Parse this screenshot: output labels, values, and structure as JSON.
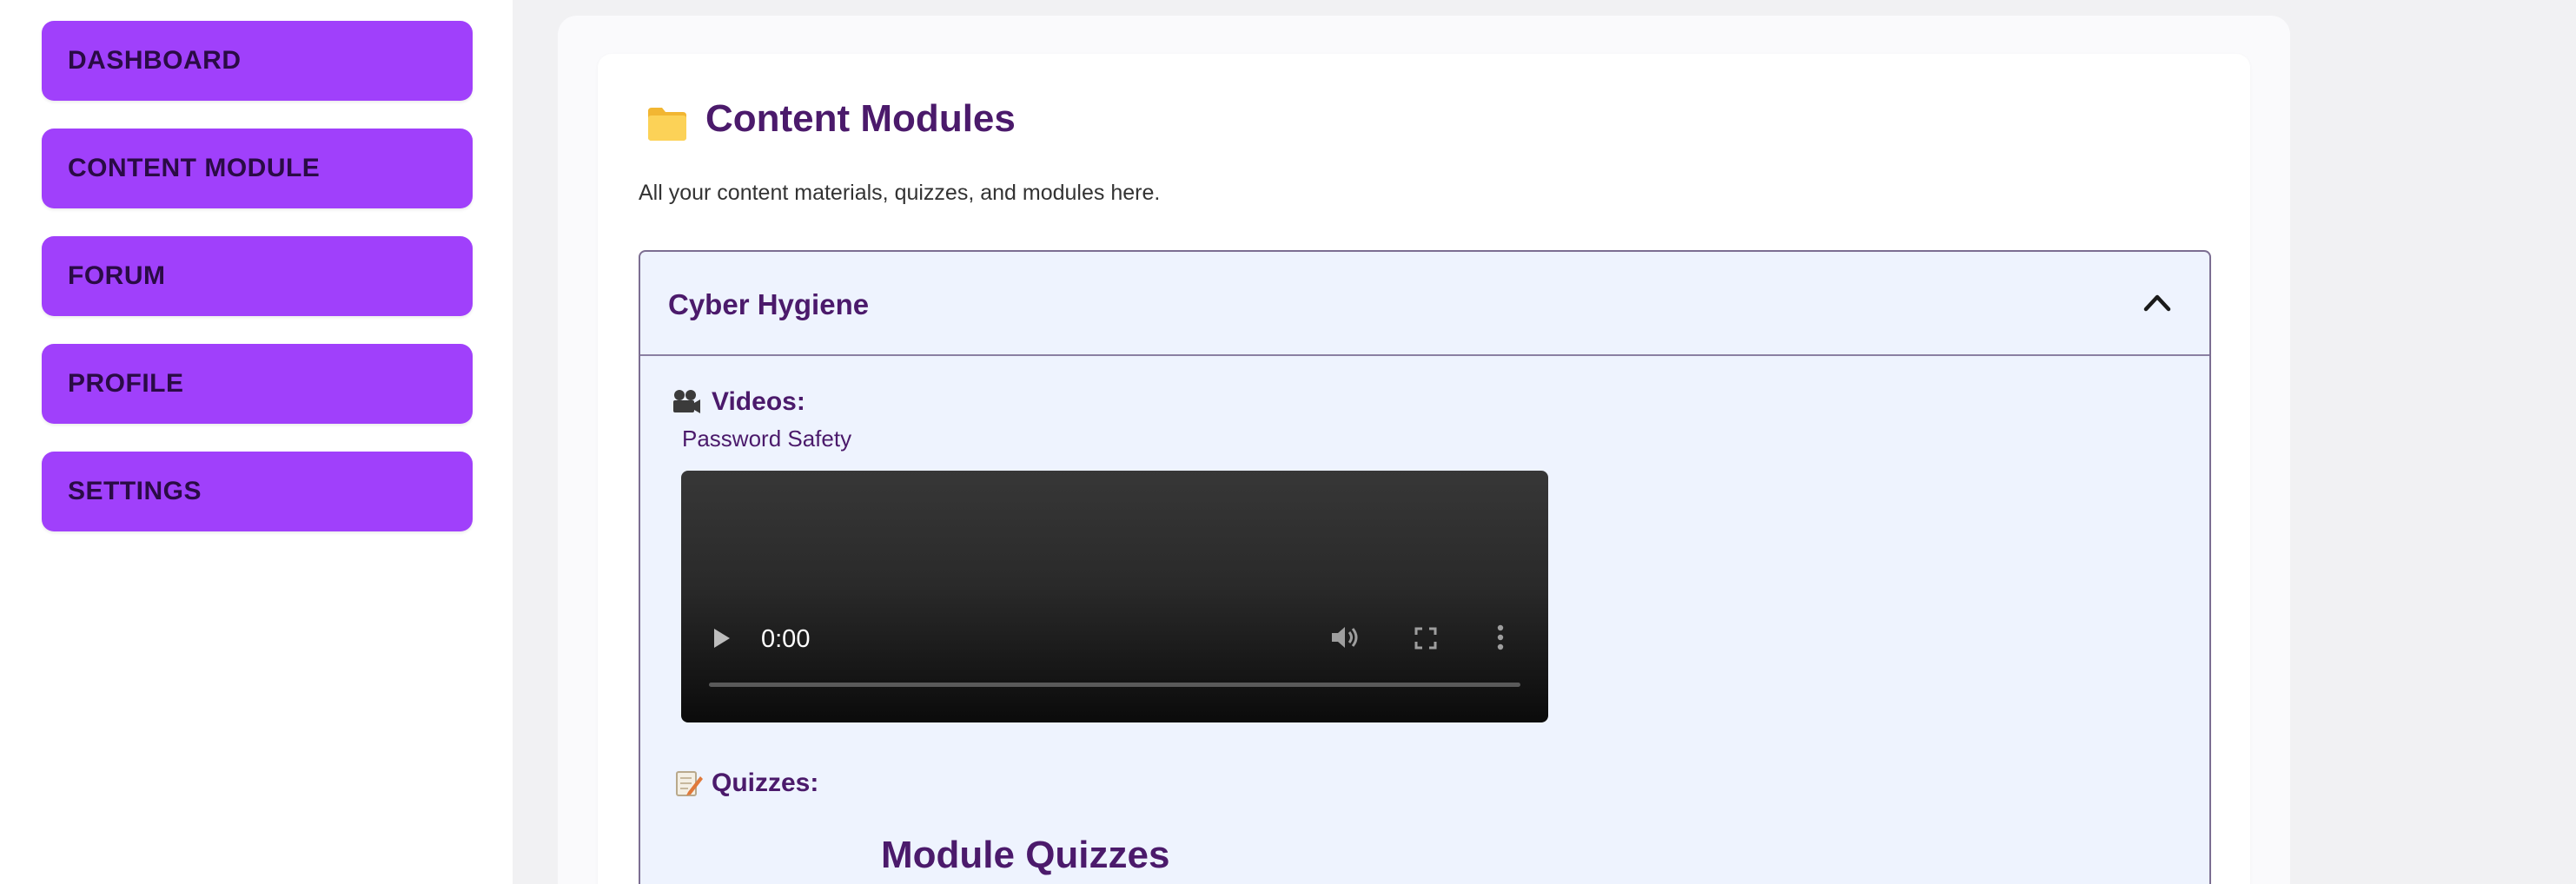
{
  "sidebar": {
    "items": [
      {
        "label": "DASHBOARD"
      },
      {
        "label": "CONTENT MODULE"
      },
      {
        "label": "FORUM"
      },
      {
        "label": "PROFILE"
      },
      {
        "label": "SETTINGS"
      }
    ]
  },
  "main": {
    "icon": "folder-icon",
    "title": "Content Modules",
    "subtitle": "All your content materials, quizzes, and modules here."
  },
  "module": {
    "title": "Cyber Hygiene",
    "expanded": true,
    "videos": {
      "icon": "projector-icon",
      "label": "Videos:",
      "items": [
        {
          "title": "Password Safety",
          "current_time": "0:00"
        }
      ]
    },
    "quizzes": {
      "icon": "memo-icon",
      "label": "Quizzes:",
      "heading": "Module Quizzes"
    }
  },
  "colors": {
    "accent": "#a040fb",
    "heading": "#4b1a6b",
    "panel_bg": "#eef3fe",
    "page_bg": "#f1f1f3"
  }
}
